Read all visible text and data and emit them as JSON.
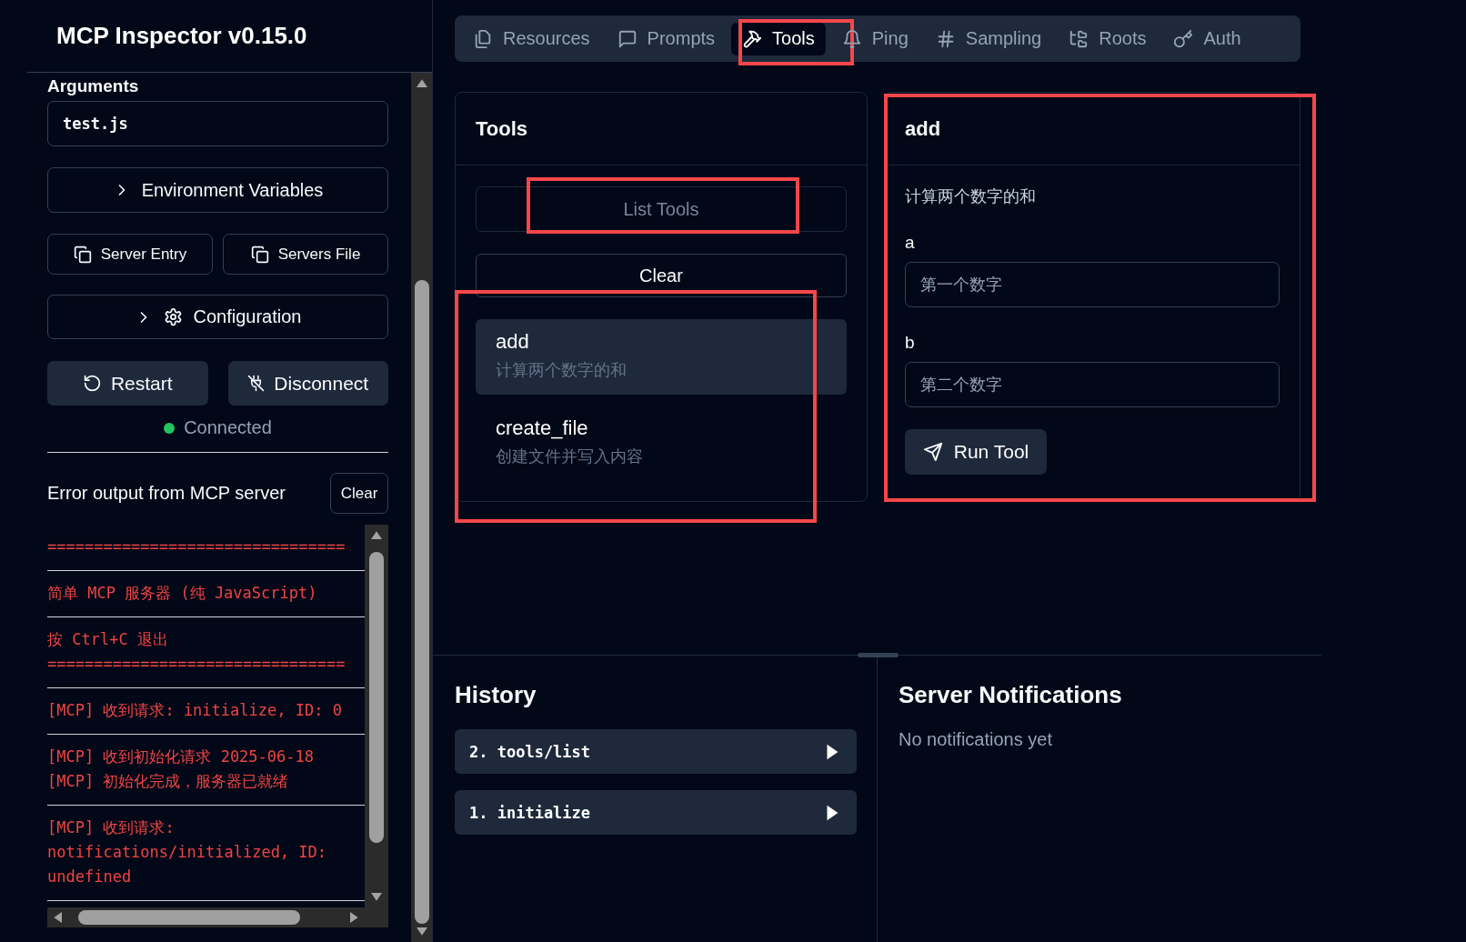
{
  "sidebar": {
    "title": "MCP Inspector v0.15.0",
    "arguments_label": "Arguments",
    "arguments_value": "test.js",
    "env_button": {
      "label": "Environment Variables",
      "expanded": false
    },
    "copy_buttons": [
      "Server Entry",
      "Servers File"
    ],
    "config_button": {
      "label": "Configuration",
      "expanded": false
    },
    "restart_button": "Restart",
    "disconnect_button": "Disconnect",
    "status": {
      "label": "Connected",
      "color": "#22c55e"
    },
    "error_output": {
      "title": "Error output from MCP server",
      "clear_button": "Clear",
      "entries": [
        {
          "lines": [
            "================================"
          ]
        },
        {
          "lines": [
            "简单 MCP 服务器 (纯 JavaScript)"
          ]
        },
        {
          "lines": [
            "按 Ctrl+C 退出",
            "================================"
          ]
        },
        {
          "lines": [
            "[MCP] 收到请求: initialize, ID: 0"
          ]
        },
        {
          "lines": [
            "[MCP] 收到初始化请求 2025-06-18",
            "[MCP] 初始化完成，服务器已就绪"
          ]
        },
        {
          "lines": [
            "[MCP] 收到请求:",
            "notifications/initialized, ID:",
            "undefined"
          ]
        }
      ]
    }
  },
  "tabs": [
    {
      "label": "Resources",
      "kind": "resources",
      "selected": false,
      "annotated": false
    },
    {
      "label": "Prompts",
      "kind": "prompts",
      "selected": false,
      "annotated": false
    },
    {
      "label": "Tools",
      "kind": "tools",
      "selected": true,
      "annotated": true
    },
    {
      "label": "Ping",
      "kind": "ping",
      "selected": false,
      "annotated": false
    },
    {
      "label": "Sampling",
      "kind": "sampling",
      "selected": false,
      "annotated": false
    },
    {
      "label": "Roots",
      "kind": "roots",
      "selected": false,
      "annotated": false
    },
    {
      "label": "Auth",
      "kind": "auth",
      "selected": false,
      "annotated": false
    }
  ],
  "tools_panel": {
    "title": "Tools",
    "list_button": {
      "label": "List Tools",
      "disabled": true,
      "annotated": true
    },
    "clear_button": "Clear",
    "annotated": true,
    "tools": [
      {
        "name": "add",
        "description": "计算两个数字的和",
        "selected": true
      },
      {
        "name": "create_file",
        "description": "创建文件并写入内容",
        "selected": false
      }
    ]
  },
  "detail": {
    "title": "add",
    "description": "计算两个数字的和",
    "annotated": true,
    "params": [
      {
        "label": "a",
        "placeholder": "第一个数字"
      },
      {
        "label": "b",
        "placeholder": "第二个数字"
      }
    ],
    "run_button": "Run Tool"
  },
  "history": {
    "title": "History",
    "items": [
      "2. tools/list",
      "1. initialize"
    ]
  },
  "notifications": {
    "title": "Server Notifications",
    "empty_text": "No notifications yet"
  }
}
